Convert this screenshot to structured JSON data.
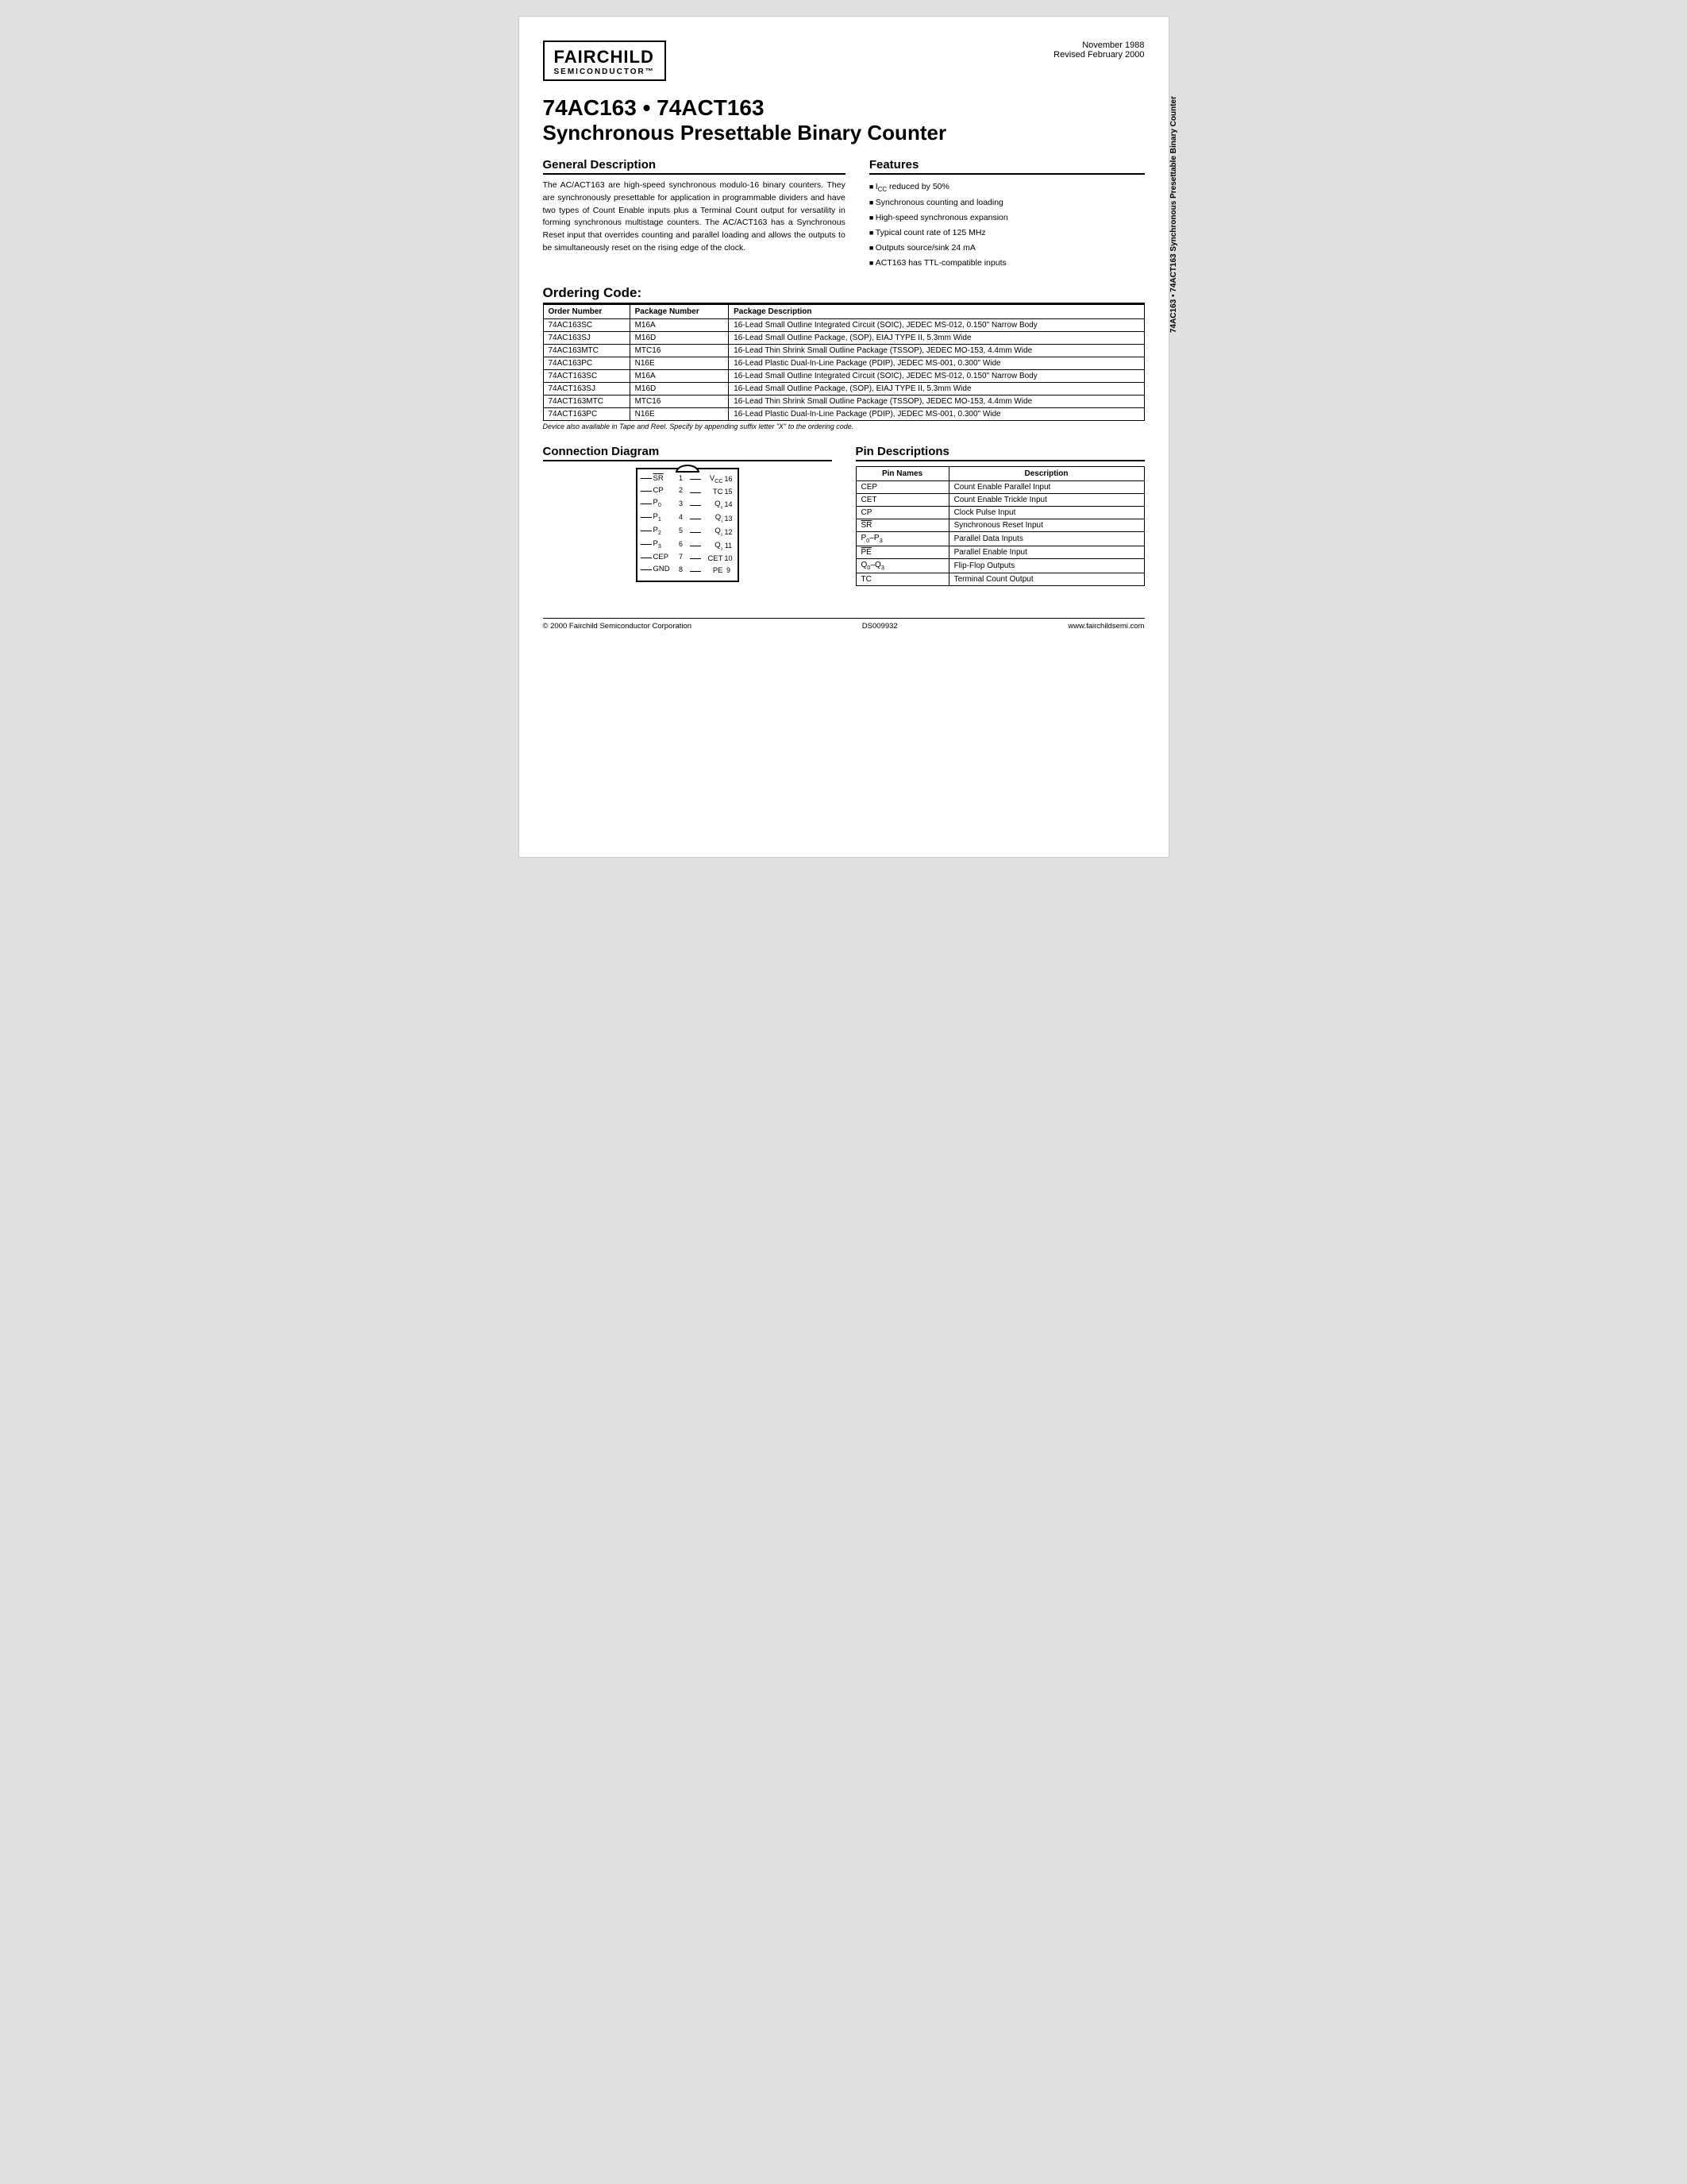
{
  "side_text": "74AC163 • 74ACT163 Synchronous Presettable Binary Counter",
  "header": {
    "date_line1": "November 1988",
    "date_line2": "Revised February 2000",
    "logo_name": "FAIRCHILD",
    "logo_sub": "SEMICONDUCTOR™"
  },
  "title": {
    "line1": "74AC163 • 74ACT163",
    "line2": "Synchronous Presettable Binary Counter"
  },
  "general_description": {
    "heading": "General Description",
    "text": "The AC/ACT163 are high-speed synchronous modulo-16 binary counters. They are synchronously presettable for application in programmable dividers and have two types of Count Enable inputs plus a Terminal Count output for versatility in forming synchronous multistage counters. The AC/ACT163 has a Synchronous Reset input that overrides counting and parallel loading and allows the outputs to be simultaneously reset on the rising edge of the clock."
  },
  "features": {
    "heading": "Features",
    "items": [
      "Iₙₑ reduced by 50%",
      "Synchronous counting and loading",
      "High-speed synchronous expansion",
      "Typical count rate of 125 MHz",
      "Outputs source/sink 24 mA",
      "ACT163 has TTL-compatible inputs"
    ]
  },
  "ordering": {
    "heading": "Ordering Code:",
    "columns": [
      "Order Number",
      "Package Number",
      "Package Description"
    ],
    "rows": [
      [
        "74AC163SC",
        "M16A",
        "16-Lead Small Outline Integrated Circuit (SOIC), JEDEC MS-012, 0.150\" Narrow Body"
      ],
      [
        "74AC163SJ",
        "M16D",
        "16-Lead Small Outline Package, (SOP), EIAJ TYPE II, 5.3mm Wide"
      ],
      [
        "74AC163MTC",
        "MTC16",
        "16-Lead Thin Shrink Small Outline Package (TSSOP), JEDEC MO-153, 4.4mm Wide"
      ],
      [
        "74AC163PC",
        "N16E",
        "16-Lead Plastic Dual-In-Line Package (PDIP), JEDEC MS-001, 0.300\" Wide"
      ],
      [
        "74ACT163SC",
        "M16A",
        "16-Lead Small Outline Integrated Circuit (SOIC), JEDEC MS-012, 0.150\" Narrow Body"
      ],
      [
        "74ACT163SJ",
        "M16D",
        "16-Lead Small Outline Package, (SOP), EIAJ TYPE II, 5.3mm Wide"
      ],
      [
        "74ACT163MTC",
        "MTC16",
        "16-Lead Thin Shrink Small Outline Package (TSSOP), JEDEC MO-153, 4.4mm Wide"
      ],
      [
        "74ACT163PC",
        "N16E",
        "16-Lead Plastic Dual-In-Line Package (PDIP), JEDEC MS-001, 0.300\" Wide"
      ]
    ],
    "footnote": "Device also available in Tape and Reel. Specify by appending suffix letter \"X\" to the ordering code."
  },
  "connection_diagram": {
    "heading": "Connection Diagram",
    "left_pins": [
      {
        "num": "1",
        "label": "SR"
      },
      {
        "num": "2",
        "label": "CP"
      },
      {
        "num": "3",
        "label": "P₀"
      },
      {
        "num": "4",
        "label": "P₁"
      },
      {
        "num": "5",
        "label": "P₂"
      },
      {
        "num": "6",
        "label": "P₃"
      },
      {
        "num": "7",
        "label": "CEP"
      },
      {
        "num": "8",
        "label": "GND"
      }
    ],
    "right_pins": [
      {
        "num": "16",
        "label": "Vᴄᴄ"
      },
      {
        "num": "15",
        "label": "TC"
      },
      {
        "num": "14",
        "label": "Q₀"
      },
      {
        "num": "13",
        "label": "Q₁"
      },
      {
        "num": "12",
        "label": "Q₂"
      },
      {
        "num": "11",
        "label": "Q₃"
      },
      {
        "num": "10",
        "label": "CET"
      },
      {
        "num": "9",
        "label": "PE"
      }
    ]
  },
  "pin_descriptions": {
    "heading": "Pin Descriptions",
    "columns": [
      "Pin Names",
      "Description"
    ],
    "rows": [
      {
        "pin": "CEP",
        "desc": "Count Enable Parallel Input"
      },
      {
        "pin": "CET",
        "desc": "Count Enable Trickle Input"
      },
      {
        "pin": "CP",
        "desc": "Clock Pulse Input"
      },
      {
        "pin": "SR",
        "desc": "Synchronous Reset Input",
        "overline": true
      },
      {
        "pin": "P₀–P₃",
        "desc": "Parallel Data Inputs"
      },
      {
        "pin": "PE",
        "desc": "Parallel Enable Input",
        "overline": true
      },
      {
        "pin": "Q₀–Q₃",
        "desc": "Flip-Flop Outputs"
      },
      {
        "pin": "TC",
        "desc": "Terminal Count Output"
      }
    ]
  },
  "footer": {
    "copyright": "© 2000 Fairchild Semiconductor Corporation",
    "doc_number": "DS009932",
    "website": "www.fairchildsemi.com"
  }
}
